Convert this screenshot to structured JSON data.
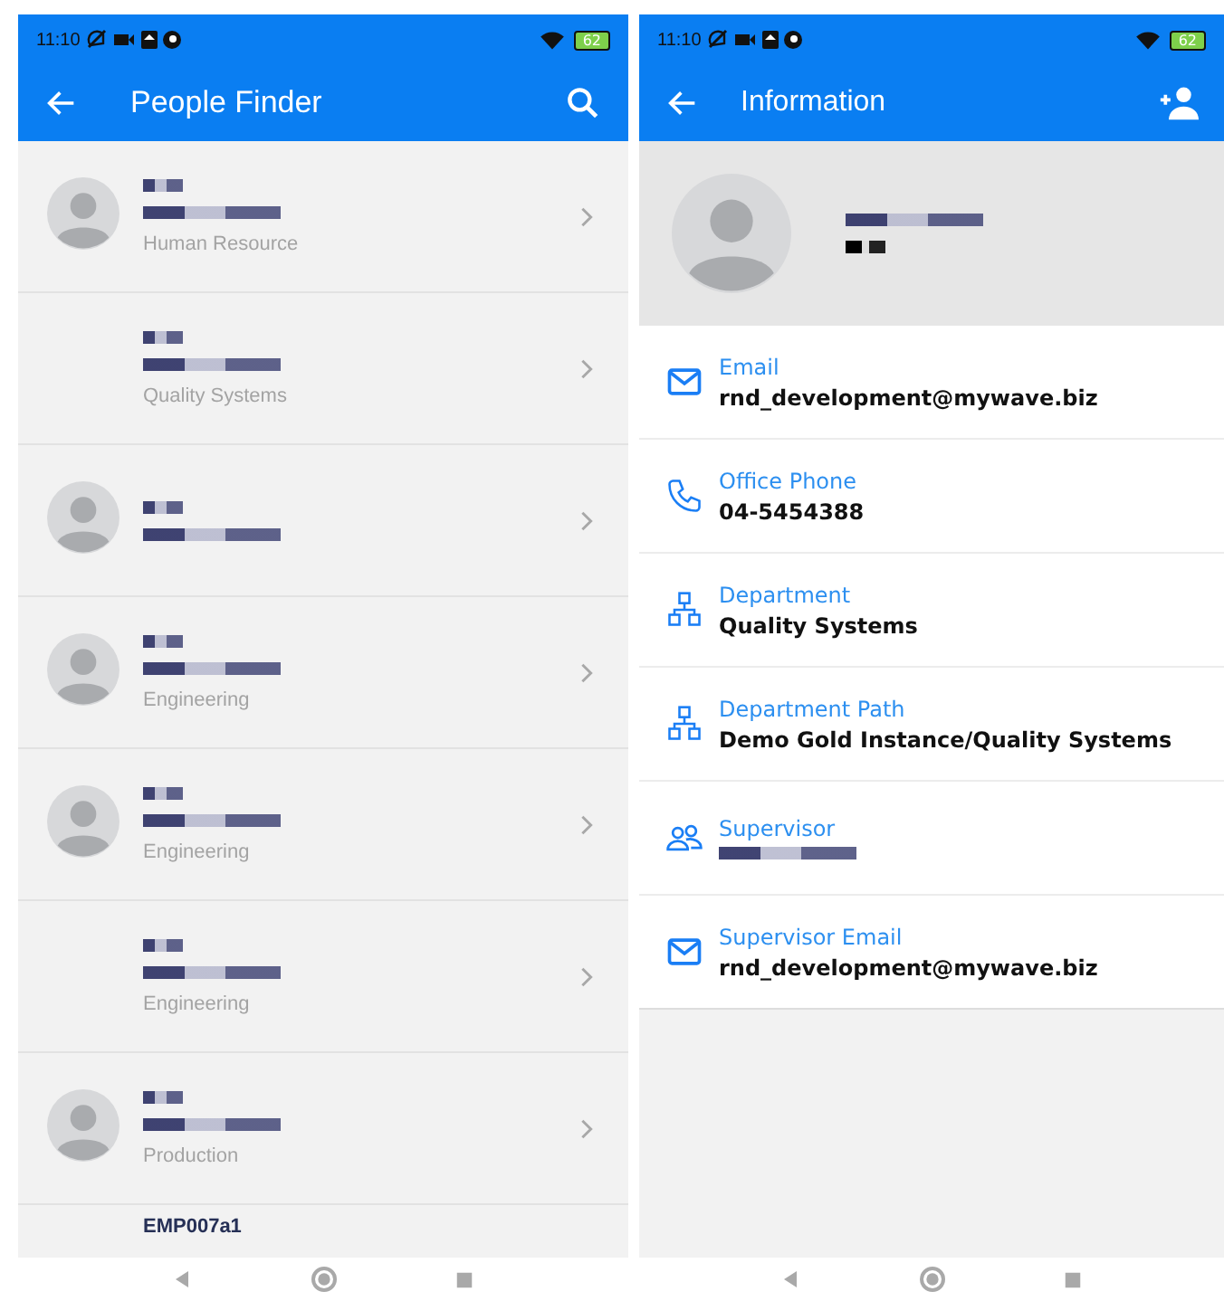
{
  "screens": [
    {
      "status_bar": {
        "time": "11:10",
        "battery": "62"
      },
      "app_bar": {
        "title": "People Finder",
        "actions": [
          {
            "kind": "search"
          }
        ]
      },
      "people": [
        {
          "has_avatar": true,
          "department": "Human Resource"
        },
        {
          "has_avatar": false,
          "department": "Quality Systems"
        },
        {
          "has_avatar": true
        },
        {
          "has_avatar": true,
          "department": "Engineering"
        },
        {
          "has_avatar": true,
          "department": "Engineering"
        },
        {
          "has_avatar": false,
          "department": "Engineering"
        },
        {
          "has_avatar": true,
          "department": "Production"
        }
      ],
      "partial_row": {
        "name": "EMP007a1"
      }
    },
    {
      "status_bar": {
        "time": "11:10",
        "battery": "62"
      },
      "app_bar": {
        "title": "Information",
        "actions": [
          {
            "kind": "add-person"
          }
        ]
      },
      "fields": [
        {
          "kind": "email",
          "label": "Email",
          "value": "rnd_development@mywave.biz"
        },
        {
          "kind": "phone",
          "label": "Office Phone",
          "value": "04-5454388"
        },
        {
          "kind": "department",
          "label": "Department",
          "value": "Quality Systems"
        },
        {
          "kind": "department",
          "label": "Department Path",
          "value": "Demo Gold Instance/Quality Systems"
        },
        {
          "kind": "people",
          "label": "Supervisor"
        },
        {
          "kind": "email",
          "label": "Supervisor Email",
          "value": "rnd_development@mywave.biz"
        }
      ]
    }
  ]
}
